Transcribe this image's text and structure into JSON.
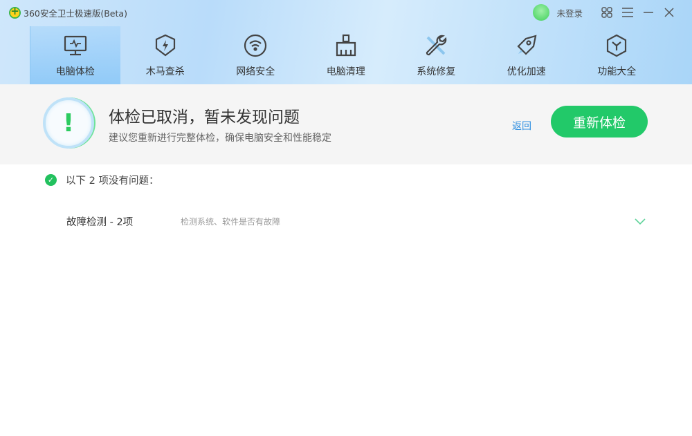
{
  "window": {
    "title": "360安全卫士极速版(Beta)",
    "login": "未登录"
  },
  "nav": [
    {
      "label": "电脑体检",
      "icon": "monitor-icon"
    },
    {
      "label": "木马查杀",
      "icon": "shield-icon"
    },
    {
      "label": "网络安全",
      "icon": "wifi-icon"
    },
    {
      "label": "电脑清理",
      "icon": "broom-icon"
    },
    {
      "label": "系统修复",
      "icon": "wrench-icon"
    },
    {
      "label": "优化加速",
      "icon": "rocket-icon"
    },
    {
      "label": "功能大全",
      "icon": "hexagon-icon"
    }
  ],
  "status": {
    "title": "体检已取消，暂未发现问题",
    "subtitle": "建议您重新进行完整体检，确保电脑安全和性能稳定",
    "back": "返回",
    "recheck": "重新体检",
    "icon_glyph": "!"
  },
  "results": {
    "ok_heading": "以下 2 项没有问题：",
    "items": [
      {
        "title": "故障检测 - 2项",
        "desc": "检测系统、软件是否有故障"
      }
    ]
  },
  "colors": {
    "accent": "#22c969",
    "link": "#2a8ce0"
  }
}
